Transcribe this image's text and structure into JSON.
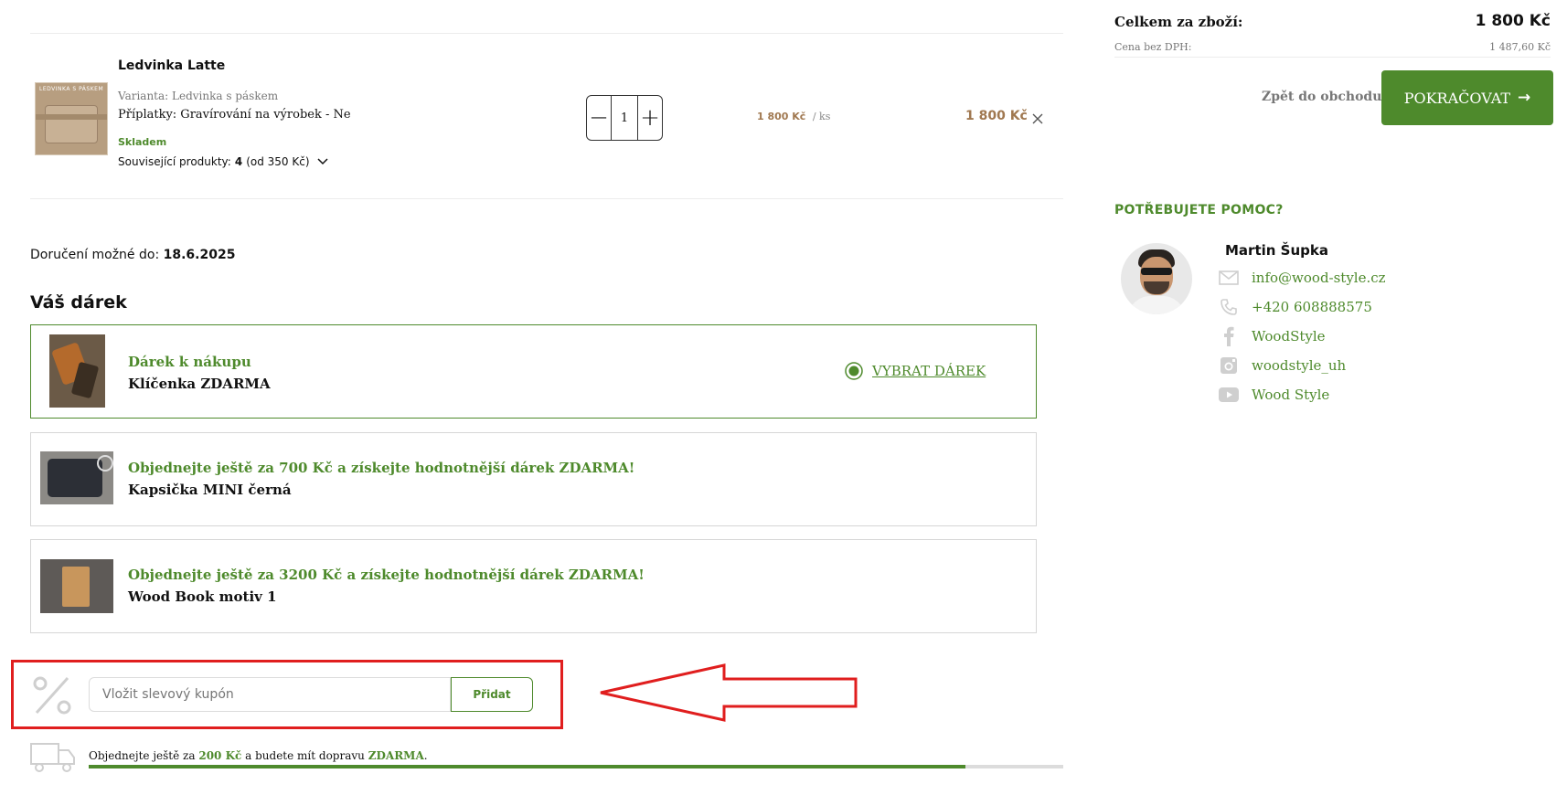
{
  "cart": {
    "item": {
      "name": "Ledvinka Latte",
      "thumb_text": "LEDVINKA S PÁSKEM",
      "variant": "Varianta: Ledvinka s páskem",
      "surcharges": "Příplatky: Gravírování na výrobek - Ne",
      "stock": "Skladem",
      "related_label": "Související produkty:",
      "related_count": "4",
      "related_price": "(od 350 Kč)",
      "quantity": "1",
      "unit_price": "1 800 Kč",
      "unit_suffix": "/ ks",
      "total_price": "1 800 Kč"
    },
    "delivery_label": "Doručení možné do:",
    "delivery_date": "18.6.2025"
  },
  "gift": {
    "heading": "Váš dárek",
    "options": [
      {
        "title": "Dárek k nákupu",
        "name": "Klíčenka ZDARMA",
        "action": "VYBRAT DÁREK",
        "selected": true
      },
      {
        "title": "Objednejte ještě za 700 Kč a získejte hodnotnější dárek ZDARMA!",
        "name": "Kapsička MINI černá"
      },
      {
        "title": "Objednejte ještě za 3200 Kč a získejte hodnotnější dárek ZDARMA!",
        "name": "Wood Book motiv 1"
      }
    ]
  },
  "coupon": {
    "placeholder": "Vložit slevový kupón",
    "button": "Přidat"
  },
  "shipping": {
    "prefix": "Objednejte ještě za",
    "amount": "200 Kč",
    "middle": "a budete mít dopravu",
    "free": "ZDARMA",
    "suffix": ".",
    "progress": 0.9
  },
  "summary": {
    "total_label": "Celkem za zboží:",
    "total_value": "1 800 Kč",
    "net_label": "Cena bez DPH:",
    "net_value": "1 487,60 Kč",
    "back_link": "Zpět do obchodu",
    "continue_button": "POKRAČOVAT",
    "continue_arrow": "→"
  },
  "help": {
    "heading": "POTŘEBUJETE POMOC?",
    "person": "Martin Šupka",
    "contacts": [
      {
        "icon": "mail-icon",
        "text": "info@wood-style.cz"
      },
      {
        "icon": "phone-icon",
        "text": "+420 608888575"
      },
      {
        "icon": "facebook-icon",
        "text": "WoodStyle"
      },
      {
        "icon": "instagram-icon",
        "text": "woodstyle_uh"
      },
      {
        "icon": "youtube-icon",
        "text": "Wood Style"
      }
    ]
  },
  "colors": {
    "accent": "#4e8a2c",
    "price": "#a07850",
    "annotation": "#e01e1e"
  }
}
